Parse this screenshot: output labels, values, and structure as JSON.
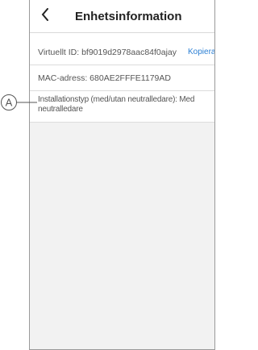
{
  "header": {
    "back_icon": "chevron-left-icon",
    "title": "Enhetsinformation"
  },
  "rows": [
    {
      "label": "Virtuellt ID: bf9019d2978aac84f0ajay",
      "action": "Kopiera"
    },
    {
      "label": "MAC-adress: 680AE2FFFE1179AD"
    },
    {
      "label": "Installationstyp (med/utan neutralledare): Med neutralledare"
    }
  ],
  "callout": {
    "letter": "A"
  },
  "colors": {
    "link": "#2b7fd4",
    "background": "#f2f2f2",
    "row_background": "#ffffff"
  }
}
